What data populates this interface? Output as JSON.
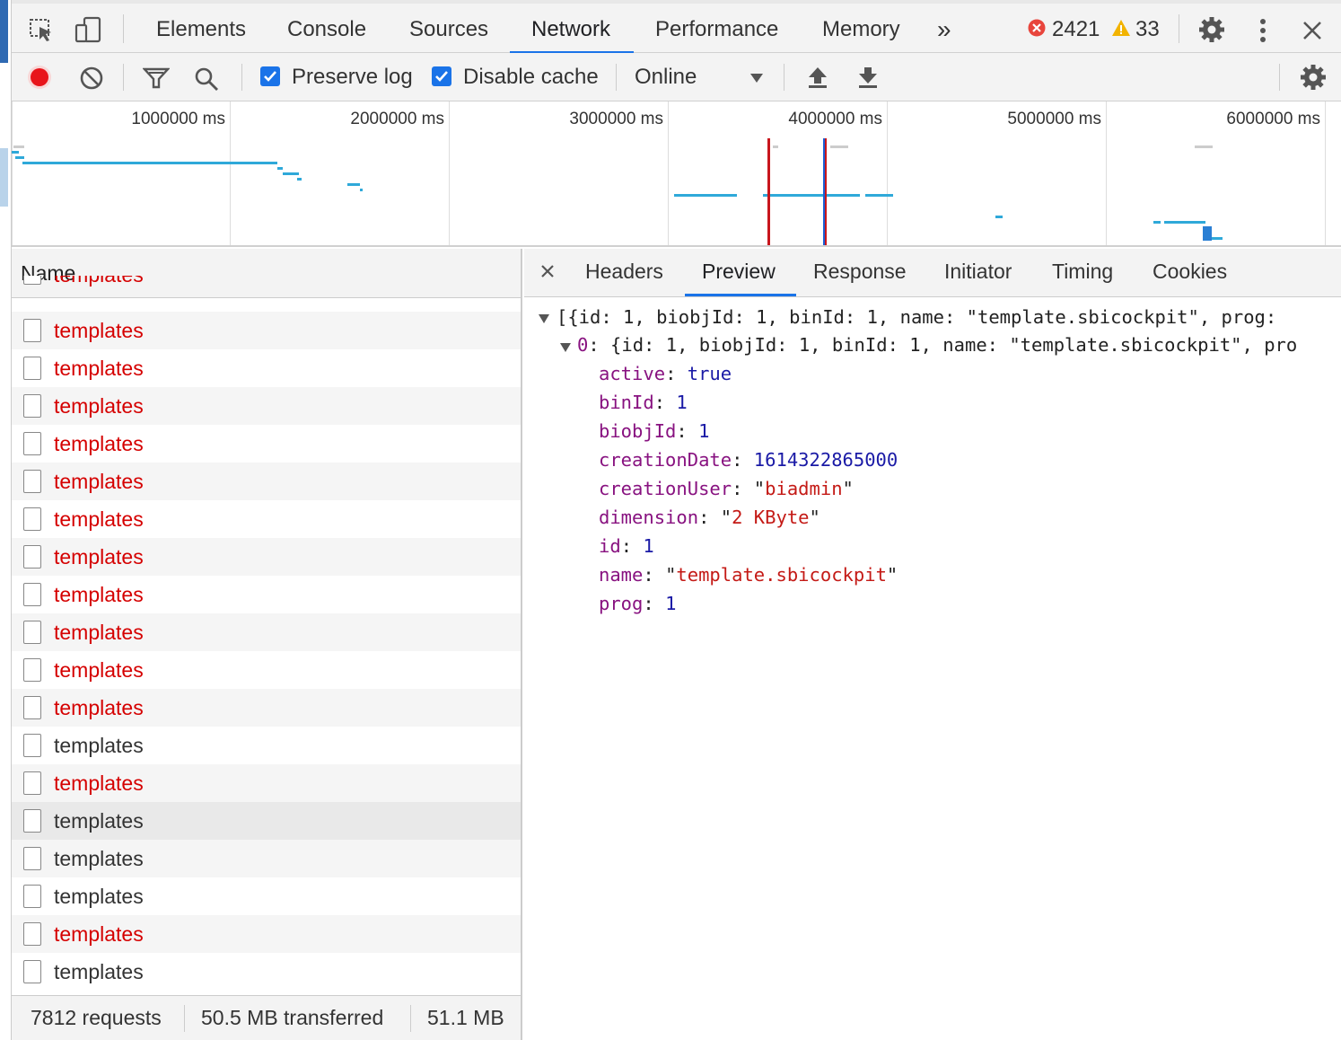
{
  "tabs": {
    "elements": "Elements",
    "console": "Console",
    "sources": "Sources",
    "network": "Network",
    "performance": "Performance",
    "memory": "Memory",
    "more": "»",
    "error_count": "2421",
    "warning_count": "33"
  },
  "toolbar": {
    "preserve_log": "Preserve log",
    "preserve_log_checked": true,
    "disable_cache": "Disable cache",
    "disable_cache_checked": true,
    "throttling": "Online"
  },
  "overview": {
    "tick_labels": [
      "1000000 ms",
      "2000000 ms",
      "3000000 ms",
      "4000000 ms",
      "5000000 ms",
      "6000000 ms"
    ]
  },
  "request_list": {
    "header": "Name",
    "rows": [
      {
        "name": "templates",
        "status": "error"
      },
      {
        "name": "templates",
        "status": "error"
      },
      {
        "name": "templates",
        "status": "error"
      },
      {
        "name": "templates",
        "status": "error"
      },
      {
        "name": "templates",
        "status": "error"
      },
      {
        "name": "templates",
        "status": "error"
      },
      {
        "name": "templates",
        "status": "error"
      },
      {
        "name": "templates",
        "status": "error"
      },
      {
        "name": "templates",
        "status": "error"
      },
      {
        "name": "templates",
        "status": "error"
      },
      {
        "name": "templates",
        "status": "error"
      },
      {
        "name": "templates",
        "status": "ok"
      },
      {
        "name": "templates",
        "status": "error"
      },
      {
        "name": "templates",
        "status": "ok",
        "selected": true
      },
      {
        "name": "templates",
        "status": "ok"
      },
      {
        "name": "templates",
        "status": "ok"
      },
      {
        "name": "templates",
        "status": "error"
      },
      {
        "name": "templates",
        "status": "ok"
      }
    ],
    "summary": {
      "requests": "7812 requests",
      "transferred": "50.5 MB transferred",
      "resources": "51.1 MB"
    }
  },
  "detail": {
    "tabs": [
      "Headers",
      "Preview",
      "Response",
      "Initiator",
      "Timing",
      "Cookies"
    ],
    "active_tab": "Preview",
    "preview": {
      "root_summary": "[{id: 1, biobjId: 1, binId: 1, name: \"template.sbicockpit\", prog:",
      "item_key": "0",
      "item_summary": " {id: 1, biobjId: 1, binId: 1, name: \"template.sbicockpit\", pro",
      "props": [
        {
          "key": "active",
          "value": "true",
          "type": "num"
        },
        {
          "key": "binId",
          "value": "1",
          "type": "num"
        },
        {
          "key": "biobjId",
          "value": "1",
          "type": "num"
        },
        {
          "key": "creationDate",
          "value": "1614322865000",
          "type": "num"
        },
        {
          "key": "creationUser",
          "value": "biadmin",
          "type": "str"
        },
        {
          "key": "dimension",
          "value": "2 KByte",
          "type": "str"
        },
        {
          "key": "id",
          "value": "1",
          "type": "num"
        },
        {
          "key": "name",
          "value": "template.sbicockpit",
          "type": "str"
        },
        {
          "key": "prog",
          "value": "1",
          "type": "num"
        }
      ]
    }
  }
}
